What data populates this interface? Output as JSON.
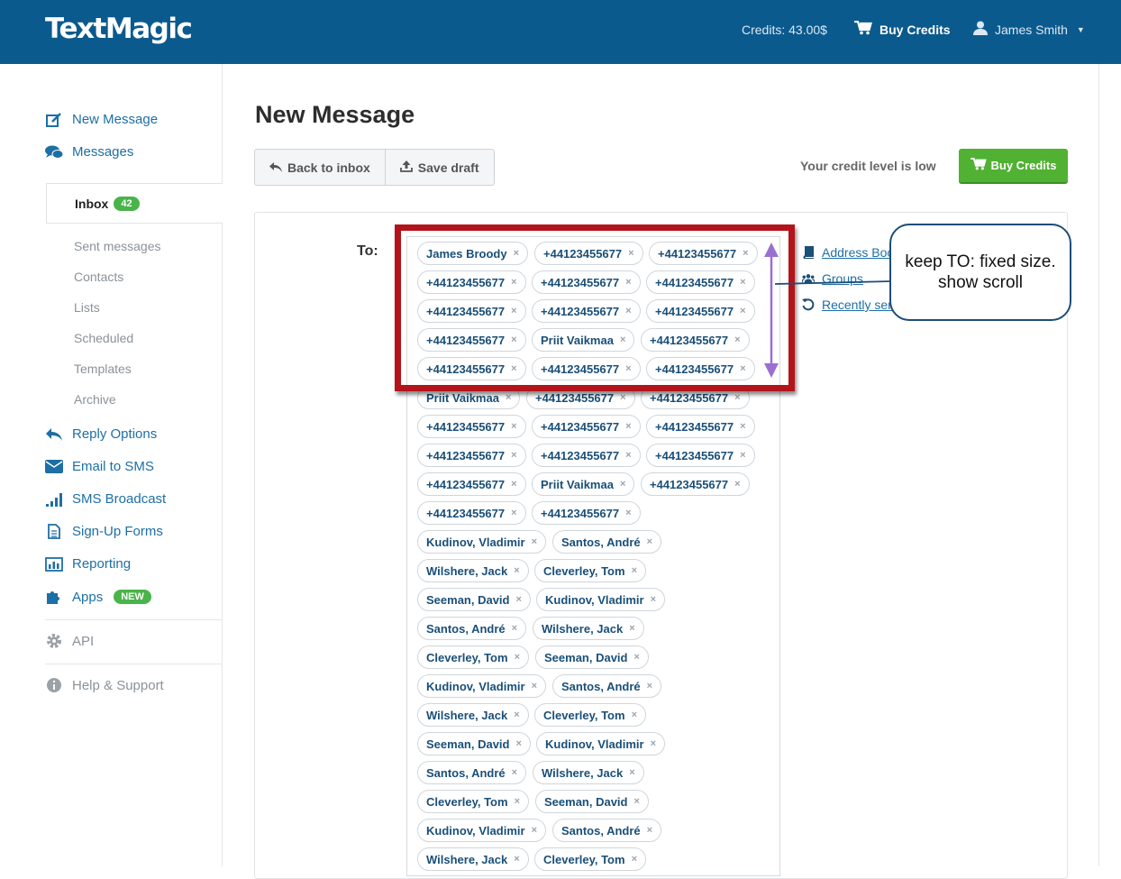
{
  "header": {
    "logo": "TextMagic",
    "credits": "Credits: 43.00$",
    "buy_credits": "Buy Credits",
    "user_name": "James Smith"
  },
  "sidebar": {
    "new_message": "New Message",
    "messages": "Messages",
    "inbox": "Inbox",
    "inbox_count": "42",
    "sub_items": [
      "Sent messages",
      "Contacts",
      "Lists",
      "Scheduled",
      "Templates",
      "Archive"
    ],
    "reply_options": "Reply Options",
    "email_to_sms": "Email to SMS",
    "sms_broadcast": "SMS Broadcast",
    "signup_forms": "Sign-Up Forms",
    "reporting": "Reporting",
    "apps": "Apps",
    "apps_badge": "NEW",
    "api": "API",
    "help": "Help & Support"
  },
  "main": {
    "title": "New Message",
    "back_to_inbox": "Back to inbox",
    "save_draft": "Save draft",
    "credit_low": "Your credit level is low",
    "buy_credits": "Buy Credits",
    "to_label": "To:",
    "recipients": [
      [
        "James Broody",
        "+44123455677",
        "+44123455677"
      ],
      [
        "+44123455677",
        "+44123455677",
        "+44123455677"
      ],
      [
        "+44123455677",
        "+44123455677",
        "+44123455677"
      ],
      [
        "+44123455677",
        "Priit Vaikmaa",
        "+44123455677"
      ],
      [
        "+44123455677",
        "+44123455677",
        "+44123455677"
      ],
      [
        "Priit Vaikmaa",
        "+44123455677",
        "+44123455677"
      ],
      [
        "+44123455677",
        "+44123455677",
        "+44123455677"
      ],
      [
        "+44123455677",
        "+44123455677",
        "+44123455677"
      ],
      [
        "+44123455677",
        "Priit Vaikmaa",
        "+44123455677"
      ],
      [
        "+44123455677",
        "+44123455677"
      ],
      [
        "Kudinov, Vladimir",
        "Santos, André"
      ],
      [
        "Wilshere, Jack",
        "Cleverley, Tom"
      ],
      [
        "Seeman, David",
        "Kudinov, Vladimir"
      ],
      [
        "Santos, André",
        "Wilshere, Jack"
      ],
      [
        "Cleverley, Tom",
        "Seeman, David"
      ],
      [
        "Kudinov, Vladimir",
        "Santos, André"
      ],
      [
        "Wilshere, Jack",
        "Cleverley, Tom"
      ],
      [
        "Seeman, David",
        "Kudinov, Vladimir"
      ],
      [
        "Santos, André",
        "Wilshere, Jack"
      ],
      [
        "Cleverley, Tom",
        "Seeman, David"
      ],
      [
        "Kudinov, Vladimir",
        "Santos, André"
      ],
      [
        "Wilshere, Jack",
        "Cleverley, Tom"
      ]
    ],
    "remove_glyph": "×",
    "address_book": "Address Book",
    "groups": "Groups",
    "recently_sent": "Recently sent"
  },
  "annotation": {
    "callout": "keep TO: fixed size. show scroll"
  },
  "colors": {
    "header_bg": "#0b5a8e",
    "link": "#1d6fa5",
    "green": "#51b132",
    "annotation_red": "#b3141b",
    "arrow_purple": "#9b6fcf"
  }
}
